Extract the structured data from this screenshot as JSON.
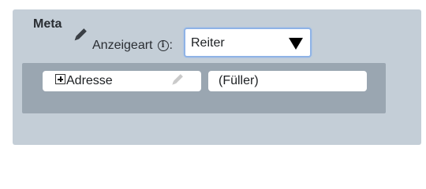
{
  "meta": {
    "title": "Meta",
    "display_label": "Anzeigeart",
    "info_glyph": "i",
    "colon": ":"
  },
  "display_select": {
    "value": "Reiter"
  },
  "fields": [
    {
      "label": "Adresse",
      "icon": "expand-icon"
    },
    {
      "label": "(Füller)"
    }
  ],
  "colors": {
    "panel": "#c4ced7",
    "field_area": "#9aa6b1",
    "select_border": "#8fb3e6"
  },
  "icons": {
    "meta_edit": "pencil-icon",
    "field_edit": "pencil-icon",
    "info": "info-icon",
    "dropdown": "triangle-down-icon"
  }
}
